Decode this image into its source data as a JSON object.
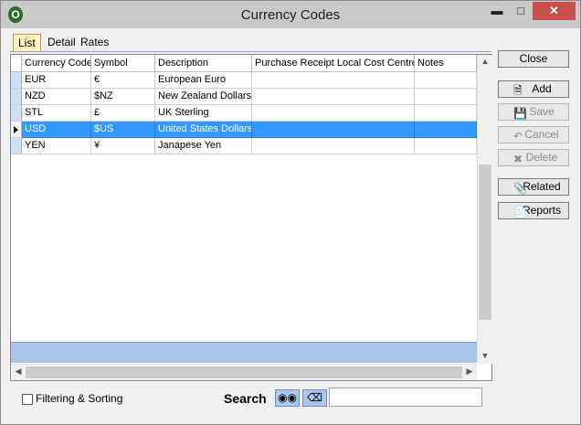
{
  "window": {
    "title": "Currency Codes",
    "app_icon": "O"
  },
  "tabs": [
    {
      "label": "List",
      "active": true
    },
    {
      "label": "Detail",
      "active": false
    },
    {
      "label": "Rates",
      "active": false
    }
  ],
  "grid": {
    "columns": [
      "Currency Code",
      "Symbol",
      "Description",
      "Purchase Receipt Local Cost Centre",
      "Notes"
    ],
    "rows": [
      {
        "code": "EUR",
        "symbol": "€",
        "description": "European Euro",
        "cost_centre": "",
        "notes": "",
        "selected": false
      },
      {
        "code": "NZD",
        "symbol": "$NZ",
        "description": "New Zealand Dollars",
        "cost_centre": "",
        "notes": "",
        "selected": false
      },
      {
        "code": "STL",
        "symbol": "£",
        "description": "UK Sterling",
        "cost_centre": "",
        "notes": "",
        "selected": false
      },
      {
        "code": "USD",
        "symbol": "$US",
        "description": "United States Dollars",
        "cost_centre": "",
        "notes": "",
        "selected": true
      },
      {
        "code": "YEN",
        "symbol": "¥",
        "description": "Janapese Yen",
        "cost_centre": "",
        "notes": "",
        "selected": false
      }
    ]
  },
  "buttons": {
    "close": "Close",
    "add": "Add",
    "save": "Save",
    "cancel": "Cancel",
    "delete": "Delete",
    "related": "Related",
    "reports": "Reports"
  },
  "bottom": {
    "filter_label": "Filtering & Sorting",
    "search_label": "Search",
    "search_value": ""
  },
  "colors": {
    "selection": "#3399ff",
    "footer_band": "#a9c4ec",
    "active_tab": "#fff0c0"
  }
}
